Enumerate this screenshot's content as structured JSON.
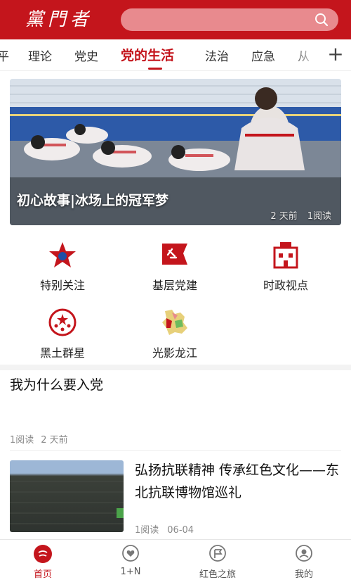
{
  "header": {
    "logo_text": "黨門者",
    "search_placeholder": ""
  },
  "tabs": [
    {
      "label": "平"
    },
    {
      "label": "理论"
    },
    {
      "label": "党史"
    },
    {
      "label": "党的生活",
      "active": true
    },
    {
      "label": "法治"
    },
    {
      "label": "应急"
    },
    {
      "label": "从"
    }
  ],
  "tabs_more_icon": "plus-icon",
  "banner": {
    "title": "初心故事|冰场上的冠军梦",
    "time": "2 天前",
    "reads": "1阅读"
  },
  "grid": [
    {
      "label": "特别关注",
      "icon": "star-icon"
    },
    {
      "label": "基层党建",
      "icon": "party-flag-icon"
    },
    {
      "label": "时政视点",
      "icon": "building-icon"
    },
    {
      "label": "黑土群星",
      "icon": "stars-circle-icon"
    },
    {
      "label": "光影龙江",
      "icon": "heilongjiang-map-icon"
    }
  ],
  "articles": [
    {
      "title": "我为什么要入党",
      "reads": "1阅读",
      "time": "2 天前"
    },
    {
      "title": "弘扬抗联精神  传承红色文化——东北抗联博物馆巡礼",
      "reads": "1阅读",
      "date": "06-04"
    }
  ],
  "bottom_nav": [
    {
      "label": "首页",
      "active": true
    },
    {
      "label": "1+N"
    },
    {
      "label": "红色之旅"
    },
    {
      "label": "我的"
    }
  ],
  "colors": {
    "brand_red": "#c4151c",
    "meta_gray": "#888888"
  }
}
